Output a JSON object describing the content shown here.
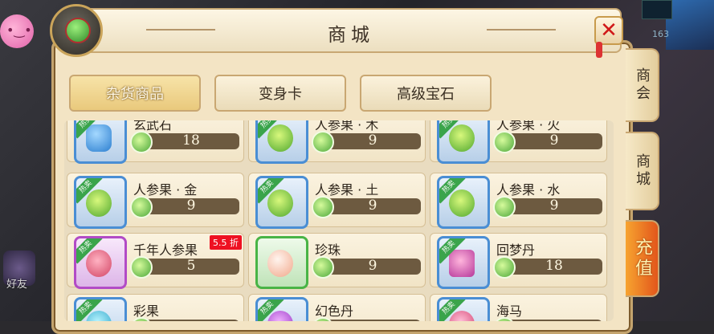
{
  "window": {
    "title": "商城",
    "close_icon": "close-icon"
  },
  "background": {
    "friend_label": "好友",
    "stat_value": "163"
  },
  "top_tabs": [
    {
      "label": "杂货商品",
      "active": true
    },
    {
      "label": "变身卡",
      "active": false
    },
    {
      "label": "高级宝石",
      "active": false
    }
  ],
  "side_tabs": [
    {
      "label": "商会"
    },
    {
      "label": "商城"
    },
    {
      "label": "充值"
    }
  ],
  "items": [
    {
      "name": "玄武石",
      "price": "18",
      "frame": "blue",
      "hot": true,
      "icon": "jade-stone-icon"
    },
    {
      "name": "人参果 · 木",
      "price": "9",
      "frame": "blue",
      "hot": true,
      "icon": "ginseng-fruit-icon"
    },
    {
      "name": "人参果 · 火",
      "price": "9",
      "frame": "blue",
      "hot": true,
      "icon": "ginseng-fruit-icon"
    },
    {
      "name": "人参果 · 金",
      "price": "9",
      "frame": "blue",
      "hot": true,
      "icon": "ginseng-fruit-icon"
    },
    {
      "name": "人参果 · 土",
      "price": "9",
      "frame": "blue",
      "hot": true,
      "icon": "ginseng-fruit-icon"
    },
    {
      "name": "人参果 · 水",
      "price": "9",
      "frame": "blue",
      "hot": true,
      "icon": "ginseng-fruit-icon"
    },
    {
      "name": "千年人参果",
      "price": "5",
      "frame": "purple",
      "hot": true,
      "icon": "peach-fruit-icon",
      "discount": "5.5 折"
    },
    {
      "name": "珍珠",
      "price": "9",
      "frame": "green",
      "hot": false,
      "icon": "pearl-icon"
    },
    {
      "name": "回梦丹",
      "price": "18",
      "frame": "blue",
      "hot": true,
      "icon": "treasure-chest-icon"
    },
    {
      "name": "彩果",
      "price": "",
      "frame": "blue",
      "hot": true,
      "icon": "colorful-fruit-icon"
    },
    {
      "name": "幻色丹",
      "price": "",
      "frame": "blue",
      "hot": true,
      "icon": "potion-icon"
    },
    {
      "name": "海马",
      "price": "",
      "frame": "blue",
      "hot": true,
      "icon": "seahorse-icon"
    }
  ],
  "labels": {
    "hot": "热卖"
  }
}
